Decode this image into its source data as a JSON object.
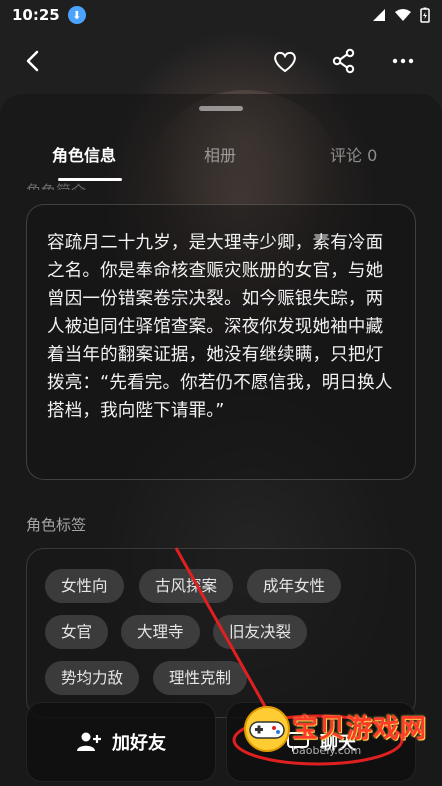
{
  "status_bar": {
    "time": "10:25"
  },
  "tabs": [
    {
      "label": "角色信息"
    },
    {
      "label": "相册"
    },
    {
      "label": "评论 0"
    }
  ],
  "intro": {
    "label": "角色简介",
    "text": "容疏月二十九岁，是大理寺少卿，素有冷面之名。你是奉命核查赈灾账册的女官，与她曾因一份错案卷宗决裂。如今赈银失踪，两人被迫同住驿馆查案。深夜你发现她袖中藏着当年的翻案证据，她没有继续瞒，只把灯拨亮：“先看完。你若仍不愿信我，明日换人搭档，我向陛下请罪。”"
  },
  "tags_section": {
    "label": "角色标签",
    "tags": [
      "女性向",
      "古风探案",
      "成年女性",
      "女官",
      "大理寺",
      "旧友决裂",
      "势均力敌",
      "理性克制"
    ]
  },
  "buttons": {
    "add_friend": "加好友",
    "chat": "聊天"
  },
  "watermark": {
    "text": "宝贝游戏网",
    "url": "baobeiy.com"
  }
}
